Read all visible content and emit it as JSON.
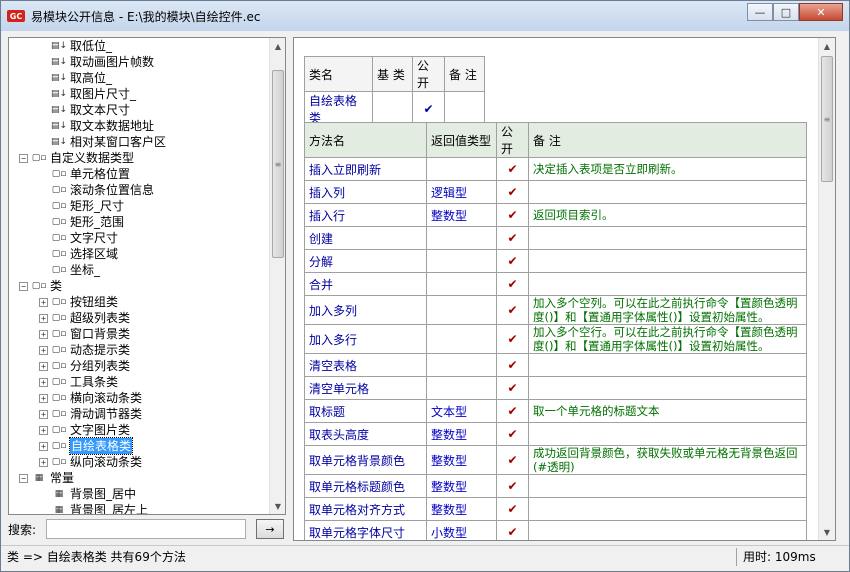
{
  "window": {
    "title": "易模块公开信息 - E:\\我的模块\\自绘控件.ec",
    "icon_text": "GC",
    "minimize": "—",
    "maximize": "□",
    "close": "✕"
  },
  "tree": {
    "items": [
      {
        "label": "取低位_",
        "level": 2,
        "icon": "method",
        "expander": ""
      },
      {
        "label": "取动画图片帧数",
        "level": 2,
        "icon": "method",
        "expander": ""
      },
      {
        "label": "取高位_",
        "level": 2,
        "icon": "method",
        "expander": ""
      },
      {
        "label": "取图片尺寸_",
        "level": 2,
        "icon": "method",
        "expander": ""
      },
      {
        "label": "取文本尺寸",
        "level": 2,
        "icon": "method",
        "expander": ""
      },
      {
        "label": "取文本数据地址",
        "level": 2,
        "icon": "method",
        "expander": ""
      },
      {
        "label": "相对某窗口客户区",
        "level": 2,
        "icon": "method",
        "expander": ""
      },
      {
        "label": "自定义数据类型",
        "level": 0,
        "icon": "type",
        "expander": "−"
      },
      {
        "label": "单元格位置",
        "level": 2,
        "icon": "type",
        "expander": ""
      },
      {
        "label": "滚动条位置信息",
        "level": 2,
        "icon": "type",
        "expander": ""
      },
      {
        "label": "矩形_尺寸",
        "level": 2,
        "icon": "type",
        "expander": ""
      },
      {
        "label": "矩形_范围",
        "level": 2,
        "icon": "type",
        "expander": ""
      },
      {
        "label": "文字尺寸",
        "level": 2,
        "icon": "type",
        "expander": ""
      },
      {
        "label": "选择区域",
        "level": 2,
        "icon": "type",
        "expander": ""
      },
      {
        "label": "坐标_",
        "level": 2,
        "icon": "type",
        "expander": ""
      },
      {
        "label": "类",
        "level": 0,
        "icon": "type",
        "expander": "−"
      },
      {
        "label": "按钮组类",
        "level": 1,
        "icon": "type",
        "expander": "+"
      },
      {
        "label": "超级列表类",
        "level": 1,
        "icon": "type",
        "expander": "+"
      },
      {
        "label": "窗口背景类",
        "level": 1,
        "icon": "type",
        "expander": "+"
      },
      {
        "label": "动态提示类",
        "level": 1,
        "icon": "type",
        "expander": "+"
      },
      {
        "label": "分组列表类",
        "level": 1,
        "icon": "type",
        "expander": "+"
      },
      {
        "label": "工具条类",
        "level": 1,
        "icon": "type",
        "expander": "+"
      },
      {
        "label": "横向滚动条类",
        "level": 1,
        "icon": "type",
        "expander": "+"
      },
      {
        "label": "滑动调节器类",
        "level": 1,
        "icon": "type",
        "expander": "+"
      },
      {
        "label": "文字图片类",
        "level": 1,
        "icon": "type",
        "expander": "+"
      },
      {
        "label": "自绘表格类",
        "level": 1,
        "icon": "type",
        "expander": "+",
        "selected": true
      },
      {
        "label": "纵向滚动条类",
        "level": 1,
        "icon": "type",
        "expander": "+"
      },
      {
        "label": "常量",
        "level": 0,
        "icon": "const",
        "expander": "−"
      },
      {
        "label": "背景图_居中",
        "level": 2,
        "icon": "const",
        "expander": ""
      },
      {
        "label": "背景图_居左上",
        "level": 2,
        "icon": "const",
        "expander": ""
      }
    ]
  },
  "search": {
    "label": "搜索:",
    "value": "",
    "button": "→"
  },
  "class_table": {
    "headers": [
      "类名",
      "基 类",
      "公开",
      "备 注"
    ],
    "row": {
      "name": "自绘表格类",
      "base": "",
      "public": "✔",
      "note": ""
    }
  },
  "method_table": {
    "headers": [
      "方法名",
      "返回值类型",
      "公开",
      "备 注"
    ],
    "rows": [
      {
        "name": "插入立即刷新",
        "type": "",
        "public": "✔",
        "note": "决定插入表项是否立即刷新。"
      },
      {
        "name": "插入列",
        "type": "逻辑型",
        "public": "✔",
        "note": ""
      },
      {
        "name": "插入行",
        "type": "整数型",
        "public": "✔",
        "note": "返回项目索引。"
      },
      {
        "name": "创建",
        "type": "",
        "public": "✔",
        "note": ""
      },
      {
        "name": "分解",
        "type": "",
        "public": "✔",
        "note": ""
      },
      {
        "name": "合并",
        "type": "",
        "public": "✔",
        "note": ""
      },
      {
        "name": "加入多列",
        "type": "",
        "public": "✔",
        "note": "加入多个空列。可以在此之前执行命令【置颜色透明度()】和【置通用字体属性()】设置初始属性。"
      },
      {
        "name": "加入多行",
        "type": "",
        "public": "✔",
        "note": "加入多个空行。可以在此之前执行命令【置颜色透明度()】和【置通用字体属性()】设置初始属性。"
      },
      {
        "name": "清空表格",
        "type": "",
        "public": "✔",
        "note": ""
      },
      {
        "name": "清空单元格",
        "type": "",
        "public": "✔",
        "note": ""
      },
      {
        "name": "取标题",
        "type": "文本型",
        "public": "✔",
        "note": "取一个单元格的标题文本"
      },
      {
        "name": "取表头高度",
        "type": "整数型",
        "public": "✔",
        "note": ""
      },
      {
        "name": "取单元格背景颜色",
        "type": "整数型",
        "public": "✔",
        "note": "成功返回背景颜色，获取失败或单元格无背景色返回(#透明)"
      },
      {
        "name": "取单元格标题颜色",
        "type": "整数型",
        "public": "✔",
        "note": ""
      },
      {
        "name": "取单元格对齐方式",
        "type": "整数型",
        "public": "✔",
        "note": ""
      },
      {
        "name": "取单元格字体尺寸",
        "type": "小数型",
        "public": "✔",
        "note": ""
      }
    ]
  },
  "status": {
    "left": "类 => 自绘表格类  共有69个方法",
    "right": "用时: 109ms"
  }
}
